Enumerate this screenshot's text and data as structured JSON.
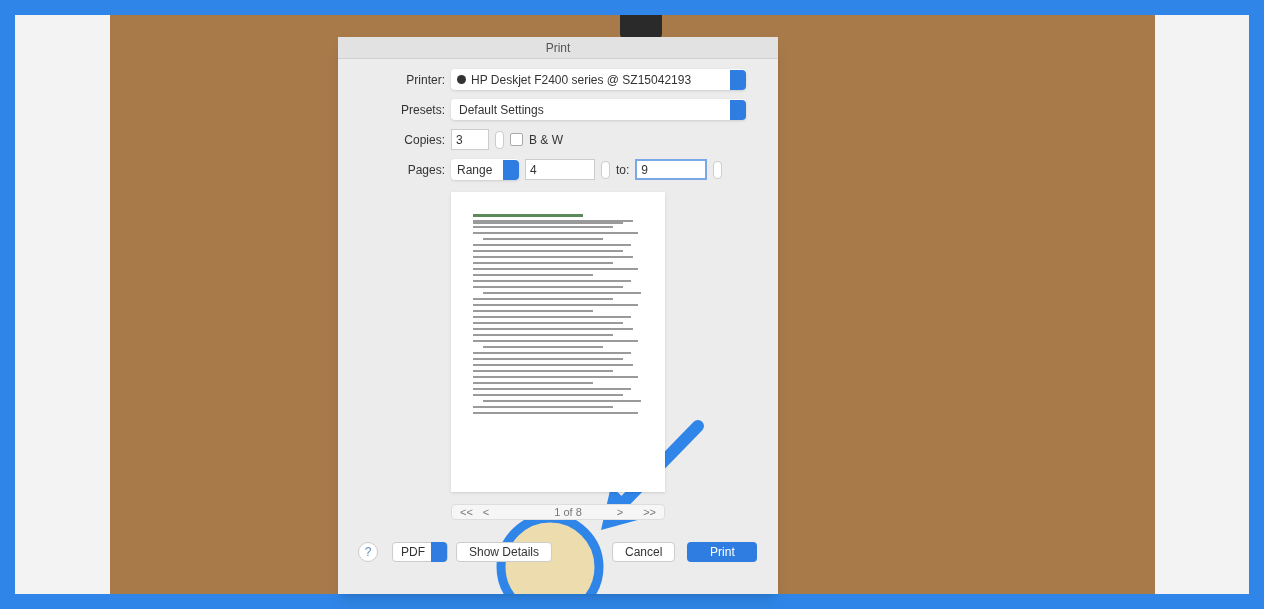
{
  "dialog": {
    "title": "Print",
    "printer": {
      "label": "Printer:",
      "value": "HP Deskjet F2400 series @ SZ15042193"
    },
    "presets": {
      "label": "Presets:",
      "value": "Default Settings"
    },
    "copies": {
      "label": "Copies:",
      "value": "3"
    },
    "black_and_white": {
      "label": "B & W",
      "checked": false
    },
    "pages": {
      "label": "Pages:",
      "mode": "Range",
      "from": "4",
      "to_label": "to:",
      "to": "9",
      "to_focused": true
    },
    "page_nav": {
      "buttons": [
        "<<",
        "<",
        ">",
        ">>"
      ],
      "position": "1 of 8"
    },
    "help": "?",
    "pdf": "PDF",
    "buttons": [
      {
        "label": "Show Details",
        "kind": "plain"
      },
      {
        "label": "Cancel",
        "kind": "plain"
      },
      {
        "label": "Print",
        "kind": "default"
      }
    ]
  }
}
